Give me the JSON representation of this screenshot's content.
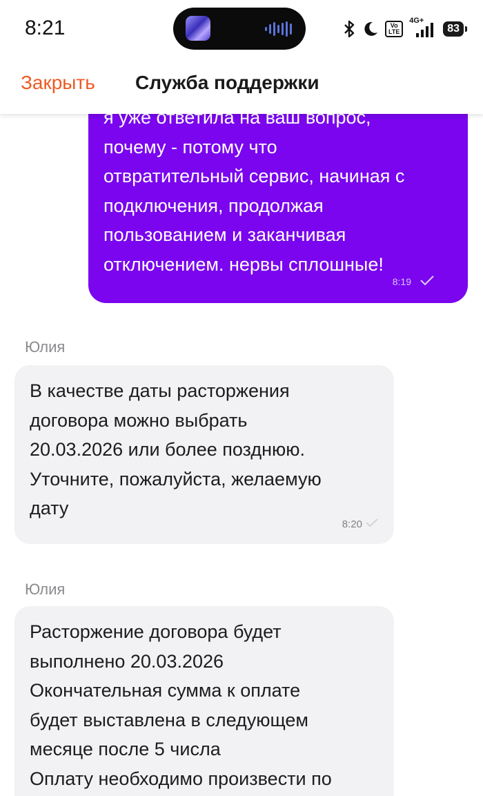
{
  "status_bar": {
    "time": "8:21",
    "network": "4G+",
    "volte": "Vo LTE",
    "battery": "83",
    "icons": [
      "bluetooth-icon",
      "moon-icon",
      "volte-icon",
      "signal-icon",
      "battery-icon"
    ]
  },
  "header": {
    "close_label": "Закрыть",
    "title": "Служба поддержки",
    "accent_color": "#ee5a24"
  },
  "messages": [
    {
      "direction": "outgoing",
      "text": "я уже ответила на ваш вопрос,\nпочему - потому что\nотвратительный сервис, начиная с\nподключения, продолжая\nпользованием и заканчивая\nотключением. нервы сплошные!",
      "time": "8:19",
      "color": "#7a05ee"
    },
    {
      "direction": "incoming",
      "sender": "Юлия",
      "text": "В качестве даты расторжения\nдоговора можно выбрать\n20.03.2026 или более позднюю.\nУточните, пожалуйста, желаемую\nдату",
      "time": "8:20"
    },
    {
      "direction": "incoming",
      "sender": "Юлия",
      "text": "Расторжение договора будет\nвыполнено 20.03.2026\nОкончательная сумма к оплате\nбудет выставлена в следующем\nмесяце после 5 числа\nОплату необходимо произвести по"
    }
  ]
}
